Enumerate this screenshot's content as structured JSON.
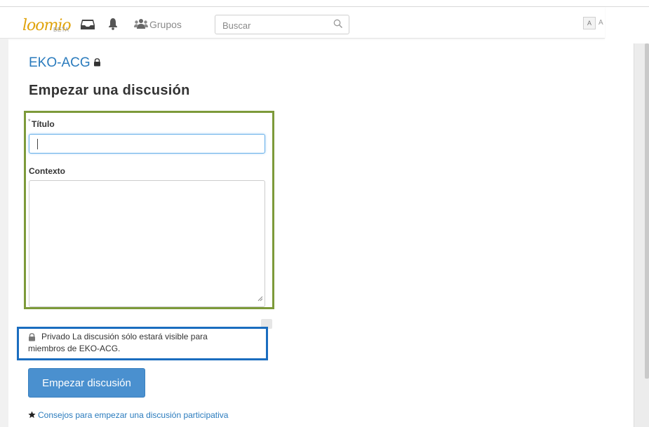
{
  "header": {
    "logo_text": "loomio",
    "beta_label": "BETA",
    "nav": {
      "inbox_icon": "inbox-icon",
      "notifications_icon": "bell-icon",
      "groups_icon": "users-icon",
      "groups_label": "Grupos"
    },
    "search": {
      "placeholder": "Buscar",
      "value": "",
      "icon": "search-icon"
    },
    "avatar_initial": "A",
    "avatar_trailing": "A"
  },
  "main": {
    "group_name": "EKO-ACG",
    "group_lock_icon": "lock-icon",
    "page_title": "Empezar una discusión",
    "form": {
      "title_required_marker": "*",
      "title_label": "Título",
      "title_value": "",
      "context_label": "Contexto",
      "context_value": ""
    },
    "privacy": {
      "icon": "lock-icon",
      "text": "Privado La discusión sólo estará visible para miembros de EKO-ACG."
    },
    "submit_label": "Empezar discusión",
    "tips": {
      "icon": "star-icon",
      "link_text": "Consejos para empezar una discusión participativa"
    }
  },
  "colors": {
    "accent": "#2a7bbd",
    "button": "#4a90cf",
    "logo": "#e0a30c",
    "form_outline": "#7d9a3a",
    "privacy_outline": "#1a6dbf"
  }
}
